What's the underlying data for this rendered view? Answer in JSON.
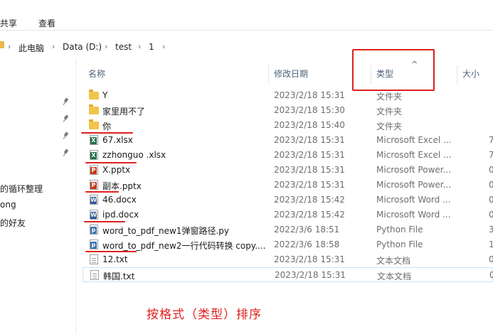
{
  "ribbon": {
    "tabs": [
      "共享",
      "查看"
    ]
  },
  "address": {
    "crumbs": [
      "此电脑",
      "Data (D:)",
      "test",
      "1"
    ]
  },
  "nav": {
    "items": [
      "的循环整理",
      "ong",
      "的好友"
    ]
  },
  "columns": {
    "name": "名称",
    "date": "修改日期",
    "type": "类型",
    "size": "大小"
  },
  "files": [
    {
      "name": "Y",
      "date": "2023/2/18 15:31",
      "type": "文件夹",
      "size": "",
      "icon": "folder-icon"
    },
    {
      "name": "家里用不了",
      "date": "2023/2/18 15:30",
      "type": "文件夹",
      "size": "",
      "icon": "folder-icon"
    },
    {
      "name": "你",
      "date": "2023/2/18 15:40",
      "type": "文件夹",
      "size": "",
      "icon": "folder-icon"
    },
    {
      "name": "67.xlsx",
      "date": "2023/2/18 15:31",
      "type": "Microsoft Excel ...",
      "size": "7",
      "icon": "excel-icon"
    },
    {
      "name": "zzhonguo .xlsx",
      "date": "2023/2/18 15:31",
      "type": "Microsoft Excel ...",
      "size": "7",
      "icon": "excel-icon"
    },
    {
      "name": "X.pptx",
      "date": "2023/2/18 15:31",
      "type": "Microsoft Power...",
      "size": "0",
      "icon": "powerpoint-icon"
    },
    {
      "name": "副本.pptx",
      "date": "2023/2/18 15:31",
      "type": "Microsoft Power...",
      "size": "0",
      "icon": "powerpoint-icon"
    },
    {
      "name": "46.docx",
      "date": "2023/2/18 15:42",
      "type": "Microsoft Word ...",
      "size": "0",
      "icon": "word-icon"
    },
    {
      "name": "ipd.docx",
      "date": "2023/2/18 15:42",
      "type": "Microsoft Word ...",
      "size": "0",
      "icon": "word-icon"
    },
    {
      "name": "word_to_pdf_new1弹窗路径.py",
      "date": "2022/3/6 18:51",
      "type": "Python File",
      "size": "3",
      "icon": "python-icon"
    },
    {
      "name": "word_to_pdf_new2一行代码转换 copy....",
      "date": "2022/3/6 18:58",
      "type": "Python File",
      "size": "1",
      "icon": "python-icon"
    },
    {
      "name": "12.txt",
      "date": "2023/2/18 15:31",
      "type": "文本文档",
      "size": "0",
      "icon": "text-file-icon"
    },
    {
      "name": "韩国.txt",
      "date": "2023/2/18 15:31",
      "type": "文本文档",
      "size": "0",
      "icon": "text-file-icon"
    }
  ],
  "annotation": "按格式（类型）排序",
  "colors": {
    "annotation": "#e02020",
    "folder": "#f3c44b",
    "header_text": "#4c607a"
  }
}
